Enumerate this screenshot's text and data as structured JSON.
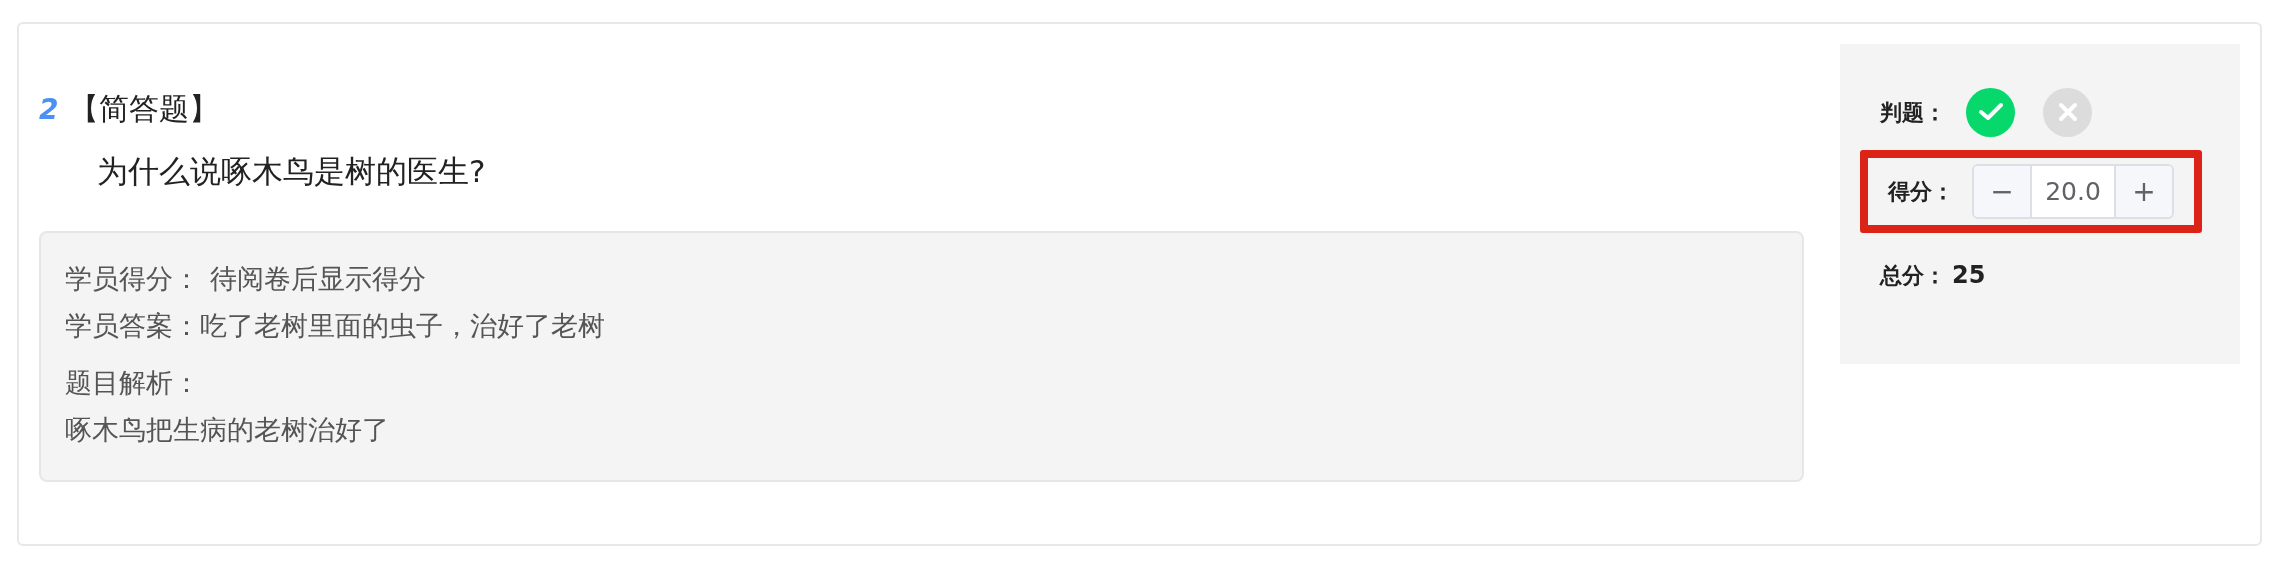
{
  "question": {
    "number": "2",
    "type": "【简答题】",
    "text": "为什么说啄木鸟是树的医生?"
  },
  "answer_box": [
    {
      "label": "学员得分：",
      "value": "待阅卷后显示得分"
    },
    {
      "label": "学员答案：",
      "value": "吃了老树里面的虫子，治好了老树"
    },
    {
      "label": "题目解析：",
      "value": "啄木鸟把生病的老树治好了"
    }
  ],
  "grading": {
    "judge_label": "判题：",
    "judge_options": [
      {
        "kind": "correct",
        "selected": true
      },
      {
        "kind": "wrong",
        "selected": false
      }
    ],
    "score_label": "得分：",
    "score_highlighted": true,
    "stepper": {
      "minus": "−",
      "value": "20.0",
      "plus": "+"
    },
    "total_label": "总分：",
    "total_value": "25"
  }
}
